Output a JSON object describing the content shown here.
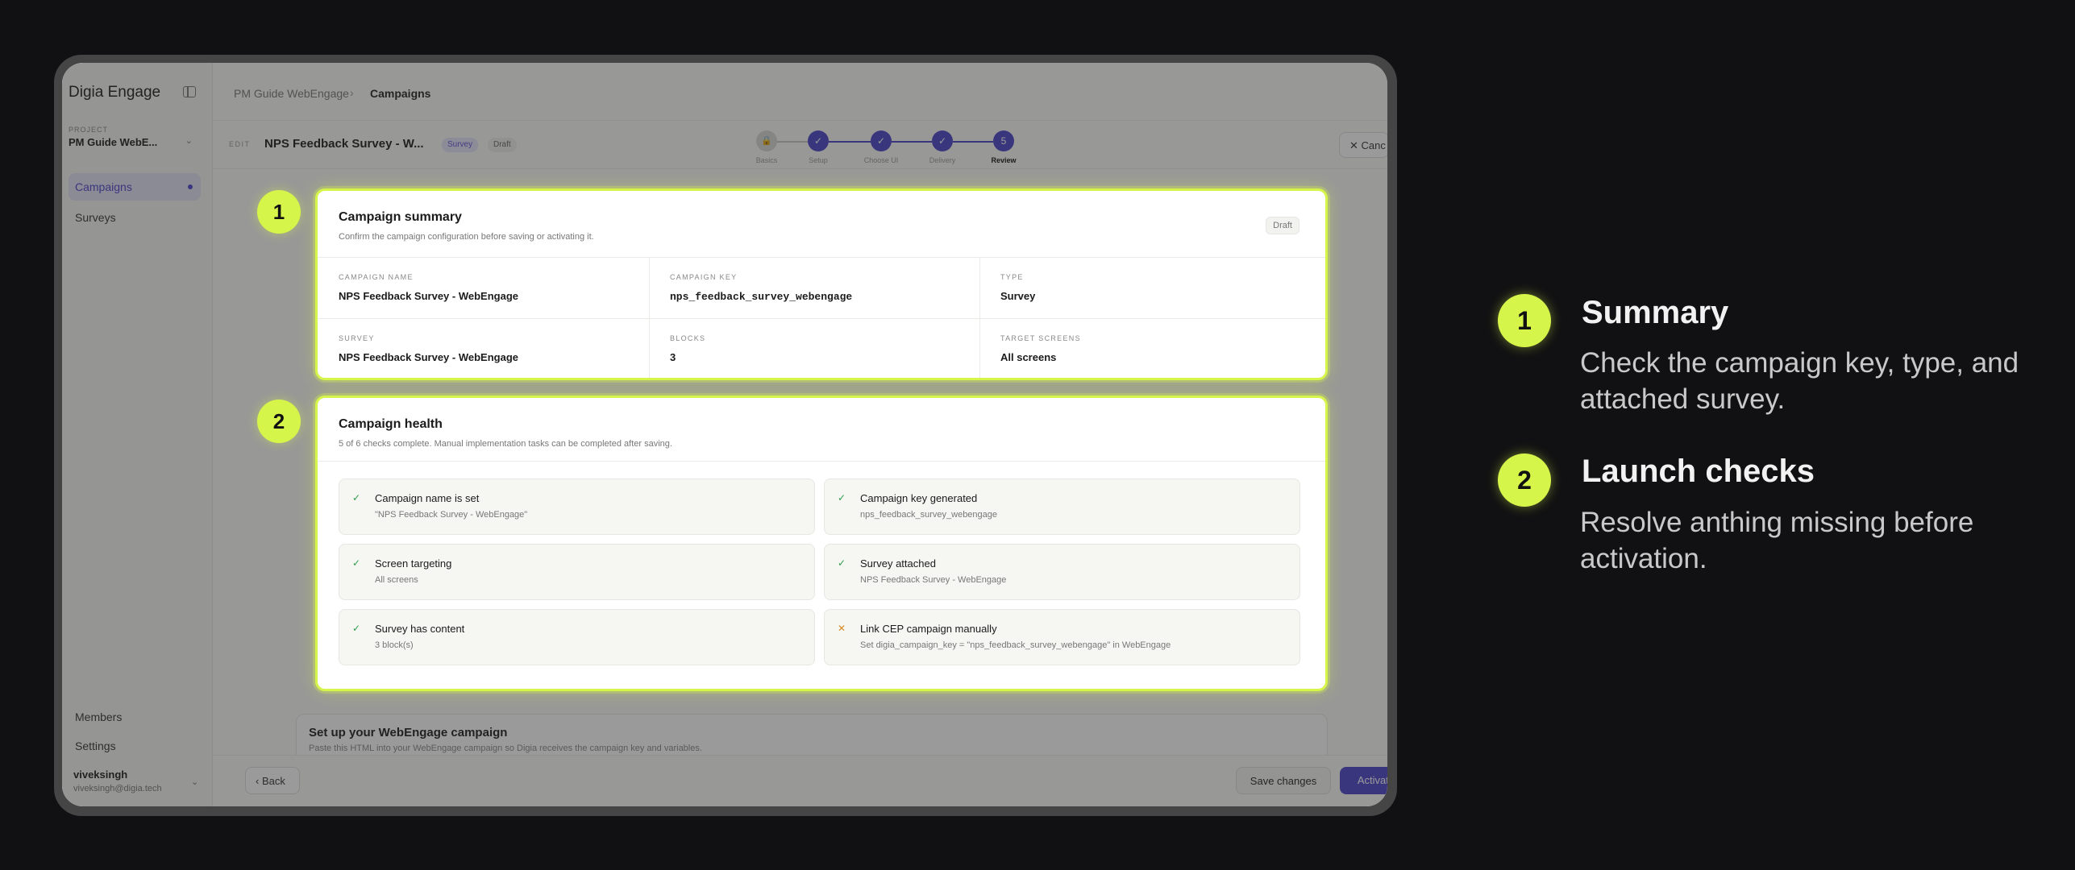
{
  "sidebar": {
    "brand": "Digia Engage",
    "project_label": "PROJECT",
    "project_name": "PM Guide WebE...",
    "nav": [
      {
        "label": "Campaigns",
        "active": true
      },
      {
        "label": "Surveys",
        "active": false
      }
    ],
    "bottom_nav": [
      {
        "label": "Members"
      },
      {
        "label": "Settings"
      }
    ],
    "user": {
      "name": "viveksingh",
      "email": "viveksingh@digia.tech"
    }
  },
  "breadcrumb": {
    "project": "PM Guide WebEngage",
    "separator": "›",
    "current": "Campaigns"
  },
  "editor": {
    "edit_label": "EDIT",
    "title": "NPS Feedback Survey - W...",
    "type_pill": "Survey",
    "status_pill": "Draft",
    "steps": [
      {
        "label": "Basics",
        "icon": "lock-icon",
        "glyph": "🔒"
      },
      {
        "label": "Setup",
        "icon": "check-icon",
        "glyph": "✓"
      },
      {
        "label": "Choose UI",
        "icon": "check-icon",
        "glyph": "✓"
      },
      {
        "label": "Delivery",
        "icon": "check-icon",
        "glyph": "✓"
      },
      {
        "label": "Review",
        "number": "5",
        "current": true
      }
    ],
    "cancel_label": "Canc"
  },
  "summary_card": {
    "title": "Campaign summary",
    "description": "Confirm the campaign configuration before saving or activating it.",
    "badge": "Draft",
    "fields": [
      {
        "label": "CAMPAIGN NAME",
        "value": "NPS Feedback Survey - WebEngage"
      },
      {
        "label": "CAMPAIGN KEY",
        "value": "nps_feedback_survey_webengage"
      },
      {
        "label": "TYPE",
        "value": "Survey"
      },
      {
        "label": "SURVEY",
        "value": "NPS Feedback Survey - WebEngage"
      },
      {
        "label": "BLOCKS",
        "value": "3"
      },
      {
        "label": "TARGET SCREENS",
        "value": "All screens"
      }
    ]
  },
  "health_card": {
    "title": "Campaign health",
    "description": "5 of 6 checks complete. Manual implementation tasks can be completed after saving.",
    "checks": [
      {
        "title": "Campaign name is set",
        "subtitle": "\"NPS Feedback Survey - WebEngage\"",
        "status": "done",
        "glyph": "✓"
      },
      {
        "title": "Campaign key generated",
        "subtitle": "nps_feedback_survey_webengage",
        "status": "done",
        "glyph": "✓"
      },
      {
        "title": "Screen targeting",
        "subtitle": "All screens",
        "status": "done",
        "glyph": "✓"
      },
      {
        "title": "Survey attached",
        "subtitle": "NPS Feedback Survey - WebEngage",
        "status": "done",
        "glyph": "✓"
      },
      {
        "title": "Survey has content",
        "subtitle": "3 block(s)",
        "status": "done",
        "glyph": "✓"
      },
      {
        "title": "Link CEP campaign manually",
        "subtitle": "Set digia_campaign_key = \"nps_feedback_survey_webengage\" in WebEngage",
        "status": "pending",
        "glyph": "✕"
      }
    ]
  },
  "setup_card": {
    "title": "Set up your WebEngage campaign",
    "description": "Paste this HTML into your WebEngage campaign so Digia receives the campaign key and variables."
  },
  "footer": {
    "back_label": "Back",
    "save_label": "Save changes",
    "activate_label": "Activate"
  },
  "annotations": [
    {
      "number": "1",
      "title": "Summary",
      "description": "Check the campaign key, type, and attached survey."
    },
    {
      "number": "2",
      "title": "Launch checks",
      "description": "Resolve anthing missing before activation."
    }
  ],
  "colors": {
    "accent": "#d6f54a",
    "primary": "#4b42c8",
    "background": "#111113"
  }
}
